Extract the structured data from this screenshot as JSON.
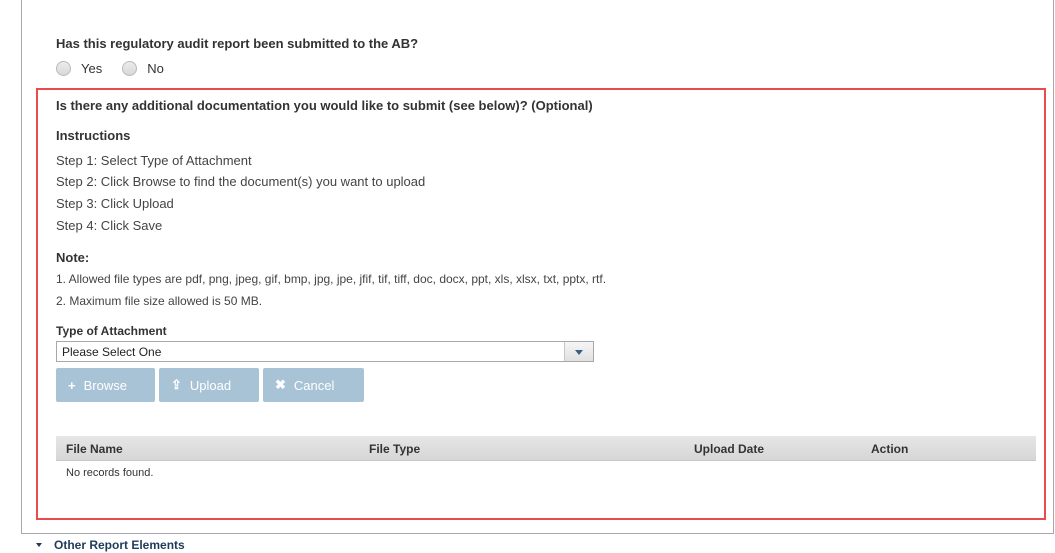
{
  "question": {
    "text": "Has this regulatory audit report been submitted to the AB?",
    "options": [
      "Yes",
      "No"
    ]
  },
  "section": {
    "title": "Is there any additional documentation you would like to submit (see below)? (Optional)",
    "instructions_heading": "Instructions",
    "steps": [
      "Step 1: Select Type of Attachment",
      "Step 2: Click Browse to find the document(s) you want to upload",
      "Step 3: Click Upload",
      "Step 4: Click Save"
    ],
    "note_heading": "Note:",
    "notes": [
      "1. Allowed file types are pdf, png, jpeg, gif, bmp, jpg, jpe, jfif, tif, tiff, doc, docx, ppt, xls, xlsx, txt, pptx, rtf.",
      "2. Maximum file size allowed is 50 MB."
    ]
  },
  "attachment": {
    "label": "Type of Attachment",
    "selected": "Please Select One"
  },
  "buttons": {
    "browse": {
      "label": "Browse",
      "icon": "plus-icon",
      "glyph": "+"
    },
    "upload": {
      "label": "Upload",
      "icon": "upload-icon",
      "glyph": "⇪"
    },
    "cancel": {
      "label": "Cancel",
      "icon": "close-icon",
      "glyph": "✖"
    }
  },
  "table": {
    "columns": [
      "File Name",
      "File Type",
      "Upload Date",
      "Action"
    ],
    "empty_message": "No records found."
  },
  "next_section": {
    "label": "Other Report Elements"
  },
  "colors": {
    "highlight": "#e84c4c",
    "button_disabled": "#a9c3d6",
    "link_dark": "#1f3b5a"
  }
}
